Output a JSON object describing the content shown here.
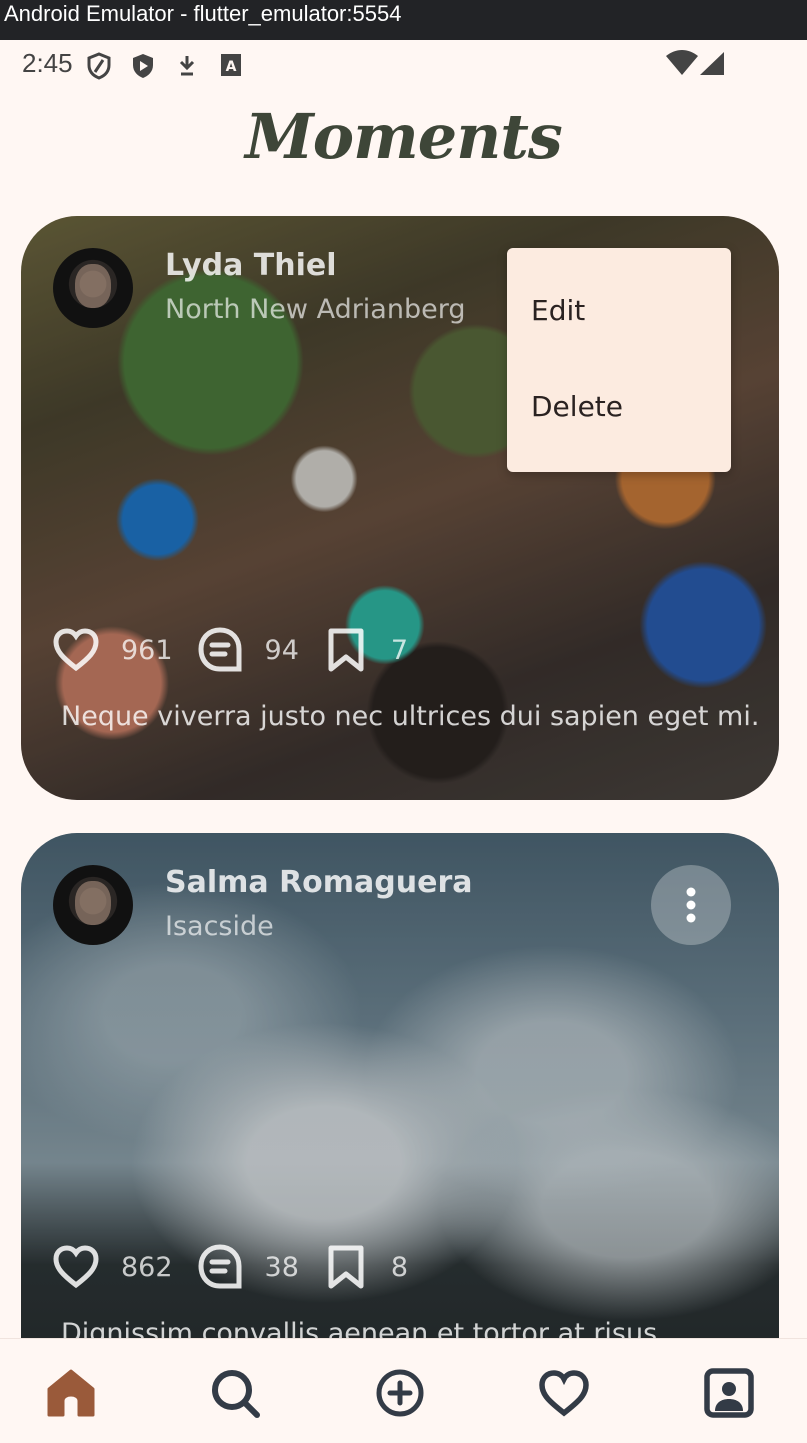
{
  "window": {
    "title": "Android Emulator - flutter_emulator:5554"
  },
  "status_bar": {
    "time": "2:45",
    "icons": [
      "shield-icon",
      "play-protect-icon",
      "download-icon",
      "keyboard-a-icon",
      "wifi-icon",
      "signal-icon"
    ]
  },
  "app": {
    "title": "Moments"
  },
  "posts": [
    {
      "user_name": "Lyda Thiel",
      "location": "North New Adrianberg",
      "likes": "961",
      "comments": "94",
      "saves": "7",
      "caption": "Neque viverra justo nec ultrices dui sapien eget mi."
    },
    {
      "user_name": "Salma Romaguera",
      "location": "Isacside",
      "likes": "862",
      "comments": "38",
      "saves": "8",
      "caption": "Dignissim convallis aenean et tortor at risus"
    }
  ],
  "context_menu": {
    "edit_label": "Edit",
    "delete_label": "Delete"
  },
  "bottom_nav": {
    "items": [
      "home-icon",
      "search-icon",
      "add-icon",
      "favorite-icon",
      "profile-icon"
    ],
    "active": "home-icon",
    "active_color": "#9a5a3a",
    "inactive_color": "#333b46"
  }
}
